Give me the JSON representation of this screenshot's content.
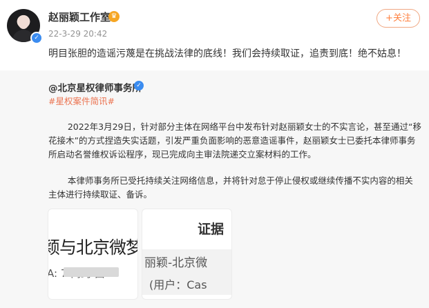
{
  "post": {
    "author": "赵丽颖工作室",
    "time": "22-3-29 20:42",
    "follow_label": "+关注",
    "text": "明目张胆的造谣污蔑是在挑战法律的底线！我们会持续取证，追责到底！绝不姑息！"
  },
  "repost": {
    "author": "@北京星权律师事务所",
    "tag": "#星权案件简讯#",
    "paragraph1": "2022年3月29日，针对部分主体在网络平台中发布针对赵丽颖女士的不实言论，甚至通过“移花接木”的方式捏造失实话题，引发严重负面影响的恶意造谣事件，赵丽颖女士已委托本律师事务所启动名誉维权诉讼程序，现已完成向主审法院递交立案材料的工作。",
    "paragraph2": "本律师事务所已受托持续关注网络信息，并将针对怠于停止侵权或继续传播不实内容的相关主体进行持续取证、备诉。",
    "images": [
      {
        "line1": "颖与北京微梦",
        "line2": "A: 7 简约 由"
      },
      {
        "line1": "证据",
        "line2": "丽颖-北京微",
        "line3": "(用户：Cas"
      }
    ]
  }
}
